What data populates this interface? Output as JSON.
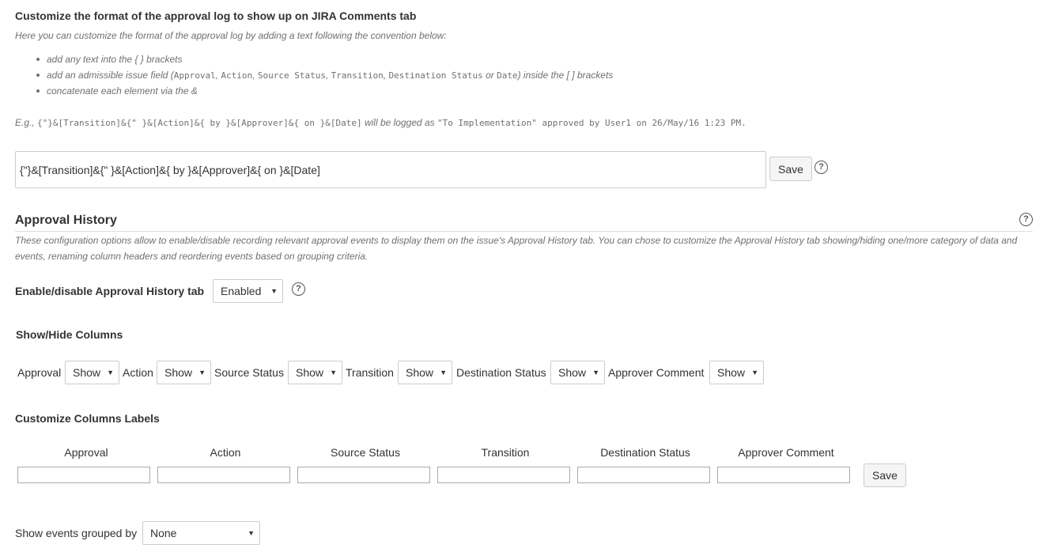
{
  "log_section": {
    "title": "Customize the format of the approval log to show up on JIRA Comments tab",
    "intro": "Here you can customize the format of the approval log by adding a text following the convention below:",
    "bullet1": "add any text into the { } brackets",
    "bullet2_pre": "add an admissible issue field (",
    "bullet2_fields": [
      {
        "name": "Approval",
        "sep": ", "
      },
      {
        "name": "Action",
        "sep": ", "
      },
      {
        "name": "Source Status",
        "sep": ", "
      },
      {
        "name": "Transition",
        "sep": ", "
      },
      {
        "name": "Destination Status",
        "sep": " or "
      },
      {
        "name": "Date",
        "sep": ""
      }
    ],
    "bullet2_post": ") inside the [ ] brackets",
    "bullet3": "concatenate each element via the &",
    "example_prefix": "E.g., ",
    "example_code": "{\"}&[Transition]&{\" }&[Action]&{ by }&[Approver]&{ on }&[Date]",
    "example_mid": " will be logged as ",
    "example_result": "\"To Implementation\" approved by User1 on 26/May/16 1:23 PM.",
    "input_value": "{\"}&[Transition]&{\" }&[Action]&{ by }&[Approver]&{ on }&[Date]",
    "save_label": "Save",
    "help_glyph": "?"
  },
  "history": {
    "title": "Approval History",
    "description": "These configuration options allow to enable/disable recording relevant approval events to display them on the issue's Approval History tab. You can chose to customize the Approval History tab showing/hiding one/more category of data and events, renaming column headers and reordering events based on grouping criteria.",
    "enable_label": "Enable/disable Approval History tab",
    "enable_value": "Enabled"
  },
  "show_hide": {
    "title": "Show/Hide Columns",
    "columns": [
      {
        "label": "Approval",
        "value": "Show"
      },
      {
        "label": "Action",
        "value": "Show"
      },
      {
        "label": "Source Status",
        "value": "Show"
      },
      {
        "label": "Transition",
        "value": "Show"
      },
      {
        "label": "Destination Status",
        "value": "Show"
      },
      {
        "label": "Approver Comment",
        "value": "Show"
      }
    ]
  },
  "labels_section": {
    "title": "Customize Columns Labels",
    "columns": [
      "Approval",
      "Action",
      "Source Status",
      "Transition",
      "Destination Status",
      "Approver Comment"
    ],
    "save_label": "Save"
  },
  "grouping": {
    "label": "Show events grouped by",
    "value": "None"
  },
  "icons": {
    "help": "help-circle-icon",
    "dropdown": "chevron-down-icon"
  },
  "colors": {
    "text": "#333333",
    "muted": "#707070",
    "border": "#cccccc",
    "button_bg": "#f5f5f5"
  }
}
